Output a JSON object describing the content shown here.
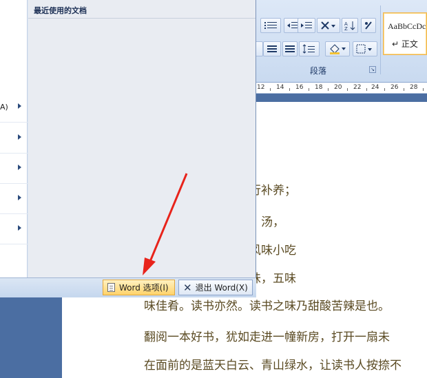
{
  "ribbon": {
    "paragraph_group_label": "段落",
    "style_gallery": {
      "sample_text": "AaBbCcDc",
      "style_name": "↵ 正文"
    }
  },
  "ruler": {
    "numbers": [
      "12",
      "14",
      "16",
      "18",
      "20",
      "22",
      "24",
      "26",
      "28"
    ]
  },
  "office_menu": {
    "recent_docs_header": "最近使用的文档",
    "left_items": [
      {
        "accel": "A)"
      },
      {
        "accel": ""
      },
      {
        "accel": ""
      },
      {
        "accel": ""
      },
      {
        "accel": ""
      }
    ],
    "word_options_label": "Word 选项(I)",
    "exit_word_label": "退出 Word(X)"
  },
  "document": {
    "lines": [
      "，吃饭，是对身体进行补养；",
      "如吃饭—饭有饭、菜、汤，",
      "有西餐、中餐、地方风味小吃",
      "讨候总要品尝一下滋味，五味",
      "味佳肴。读书亦然。读书之味乃甜酸苦辣是也。",
      "翻阅一本好书，犹如走进一幢新房，打开一扇未",
      "在面前的是蓝天白云、青山绿水，让读书人按捺不"
    ]
  },
  "colors": {
    "annotation_arrow": "#e8231b",
    "text_color": "#5a4a22",
    "doc_background": "#4b6ea2"
  }
}
